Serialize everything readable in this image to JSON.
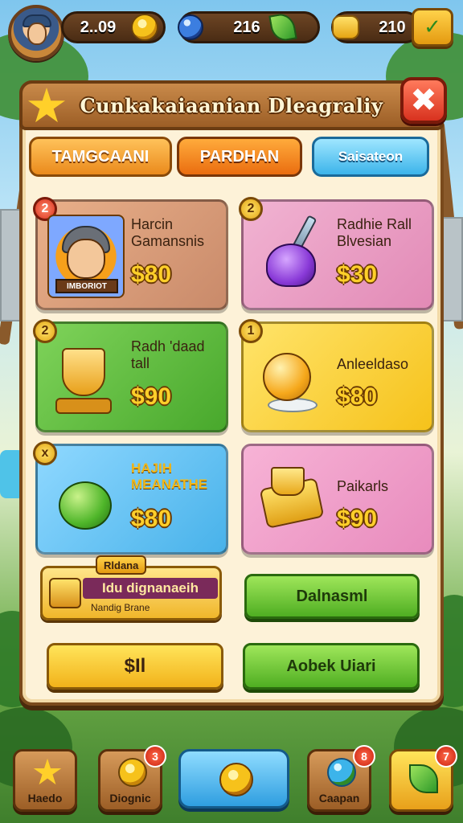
{
  "hud": {
    "coins_value": "2..09",
    "gems_value": "216",
    "gold_value": "210"
  },
  "window": {
    "title": "Cunkakaiaanian Dleagraliy"
  },
  "tabs": [
    {
      "label": "TAMGCAANI"
    },
    {
      "label": "PARDHAN"
    },
    {
      "label": "Saisateon"
    }
  ],
  "items": [
    {
      "badge": "2",
      "name": "Harcin Gamansnis",
      "price": "$80",
      "art_label": "IMBORIOT"
    },
    {
      "badge": "2",
      "name": "Radhie Rall Blvesian",
      "price": "$30"
    },
    {
      "badge": "2",
      "name": "Radh 'daad tall",
      "price": "$90"
    },
    {
      "badge": "1",
      "name": "Anleeldaso",
      "price": "$80"
    },
    {
      "badge": "x",
      "name": "HAJIH MEANATHE",
      "price": "$80"
    },
    {
      "badge": "",
      "name": "Paikarls",
      "price": "$90"
    }
  ],
  "promo": {
    "tag": "Rldana",
    "title": "Idu dignanaeih",
    "subtitle": "Nandig Brane"
  },
  "buttons": {
    "daily": "Dalnasml",
    "pay": "$Il",
    "ask": "Aobek Uiari"
  },
  "nav": [
    {
      "label": "Haedo",
      "icon": "star-icon",
      "badge": ""
    },
    {
      "label": "Diognic",
      "icon": "coin-icon",
      "badge": "3"
    },
    {
      "label": "",
      "icon": "compass-icon",
      "badge": ""
    },
    {
      "label": "Caapan",
      "icon": "globe-icon",
      "badge": "8"
    },
    {
      "label": "",
      "icon": "leaf-icon",
      "badge": "7"
    }
  ],
  "colors": {
    "panel_bg": "#fdf2d8",
    "wood": "#9c5e26",
    "price_gold": "#ffcf2a",
    "close_red": "#d8321f"
  }
}
